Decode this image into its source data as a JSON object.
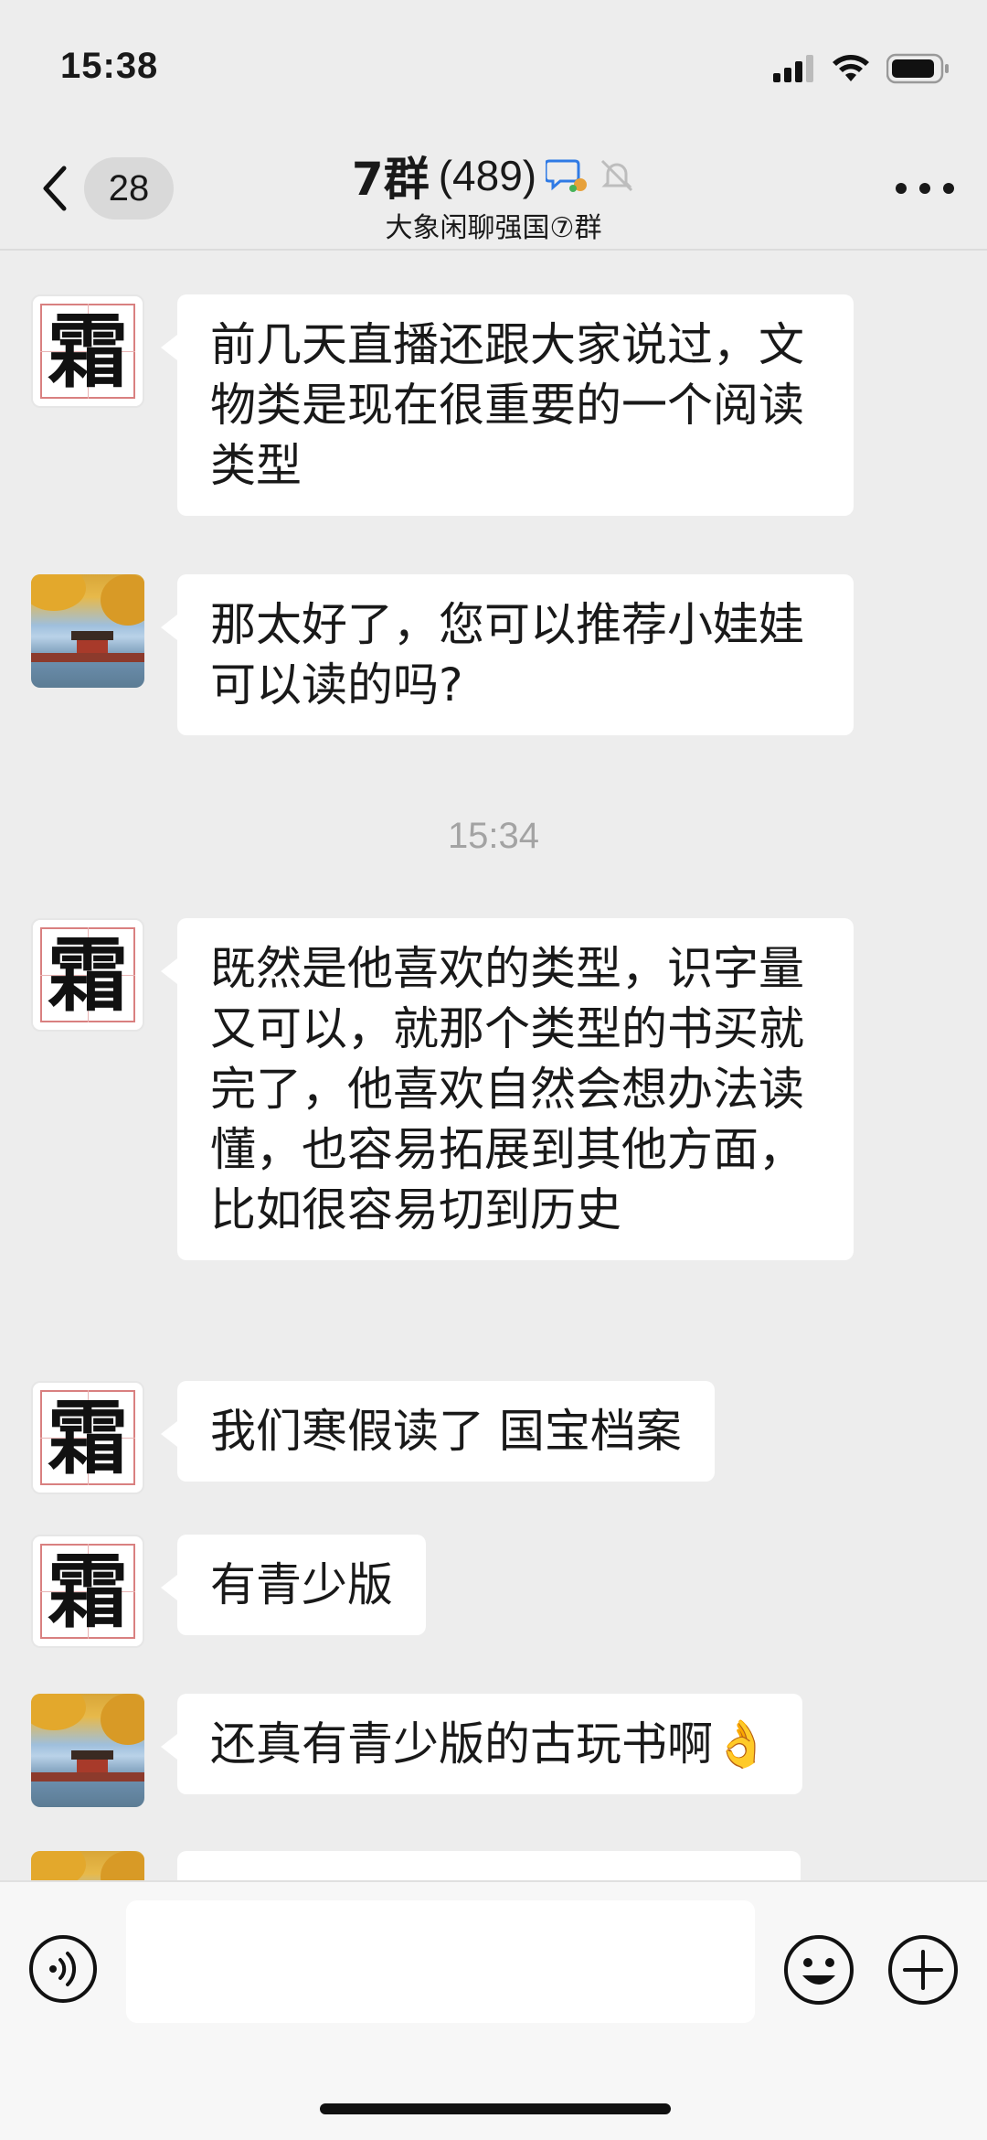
{
  "status_bar": {
    "time": "15:38"
  },
  "header": {
    "back_badge": "28",
    "group_name": "7群",
    "member_count": "(489)",
    "subtitle": "大象闲聊强国⑦群"
  },
  "messages": [
    {
      "avatar": "shuang-avatar",
      "avatar_char": "霜",
      "text": "前几天直播还跟大家说过，文物类是现在很重要的一个阅读类型"
    },
    {
      "avatar": "palace-photo-avatar",
      "text": "那太好了，您可以推荐小娃娃可以读的吗?"
    },
    {
      "timestamp": "15:34"
    },
    {
      "avatar": "shuang-avatar",
      "avatar_char": "霜",
      "text": "既然是他喜欢的类型，识字量又可以，就那个类型的书买就完了，他喜欢自然会想办法读懂，也容易拓展到其他方面，比如很容易切到历史"
    },
    {
      "avatar": "shuang-avatar",
      "avatar_char": "霜",
      "text": "我们寒假读了 国宝档案"
    },
    {
      "avatar": "shuang-avatar",
      "avatar_char": "霜",
      "text": "有青少版"
    },
    {
      "avatar": "palace-photo-avatar",
      "text": "还真有青少版的古玩书啊👌"
    }
  ],
  "input_bar": {
    "voice_icon": "voice-icon",
    "emoji_icon": "emoji-icon",
    "plus_icon": "plus-icon",
    "placeholder": ""
  },
  "colors": {
    "background": "#ededed",
    "bubble": "#ffffff",
    "timestamp": "#a3a3a3"
  }
}
